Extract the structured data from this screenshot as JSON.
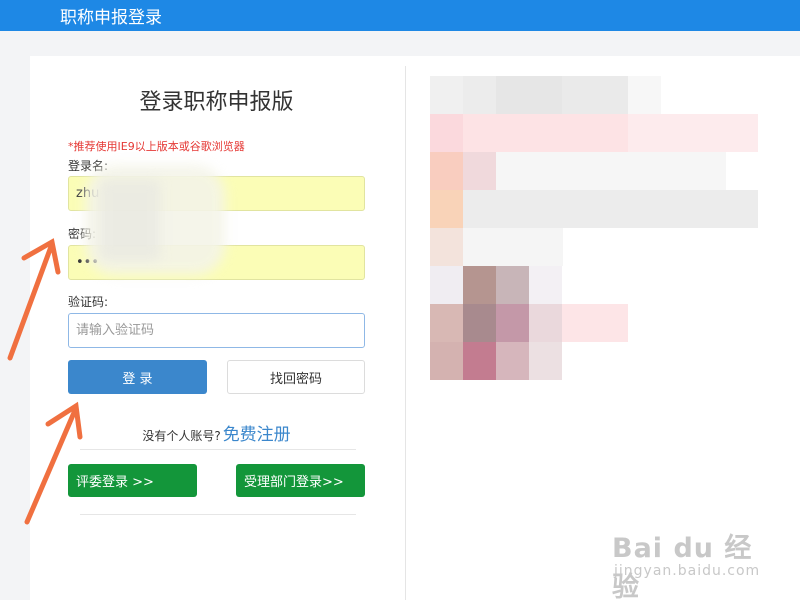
{
  "header": {
    "title": "职称申报登录"
  },
  "login": {
    "title": "登录职称申报版",
    "browser_tip": "*推荐使用IE9以上版本或谷歌浏览器",
    "username_label": "登录名:",
    "username_value": "zhu",
    "password_label": "密码:",
    "password_mask": "•••",
    "captcha_label": "验证码:",
    "captcha_placeholder": "请输入验证码",
    "login_button": "登 录",
    "forgot_button": "找回密码",
    "no_account": "没有个人账号?",
    "register_link": "免费注册",
    "judge_login": "评委登录 >>",
    "dept_login": "受理部门登录>>"
  },
  "colors": {
    "header": "#1e88e5",
    "login_button": "#3b87cc",
    "green_buttons": "#13963a",
    "error_text": "#e53935",
    "annotation_arrow": "#f07040"
  },
  "watermark": {
    "brand": "Bai du 经验",
    "url": "jingyan.baidu.com"
  }
}
